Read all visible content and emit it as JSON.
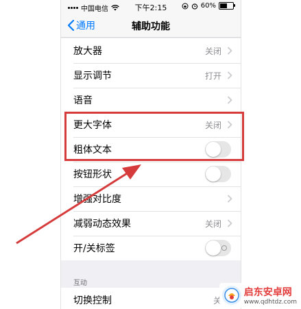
{
  "status_bar": {
    "carrier": "中国电信",
    "time": "下午2:15",
    "battery": "60%",
    "battery_level": 0.6
  },
  "nav": {
    "back_label": "通用",
    "title": "辅助功能"
  },
  "rows": [
    {
      "label": "放大器",
      "value": "关闭",
      "type": "link"
    },
    {
      "label": "显示调节",
      "value": "打开",
      "type": "link"
    },
    {
      "label": "语音",
      "value": "",
      "type": "link"
    },
    {
      "label": "更大字体",
      "value": "关闭",
      "type": "link"
    },
    {
      "label": "粗体文本",
      "type": "toggle",
      "on": false
    },
    {
      "label": "按钮形状",
      "type": "toggle",
      "on": false
    },
    {
      "label": "增强对比度",
      "value": "",
      "type": "link"
    },
    {
      "label": "减弱动态效果",
      "value": "关闭",
      "type": "link"
    },
    {
      "label": "开/关标签",
      "type": "toggle",
      "on": false
    }
  ],
  "section2": {
    "header": "互动",
    "rows": [
      {
        "label": "切换控制",
        "value": "关",
        "type": "link"
      }
    ]
  },
  "annotation": {
    "box_color": "#d63b3b",
    "arrow_color": "#d63b3b"
  },
  "watermark": {
    "name": "启东安卓网",
    "url": "www.qdhtdz.com"
  }
}
